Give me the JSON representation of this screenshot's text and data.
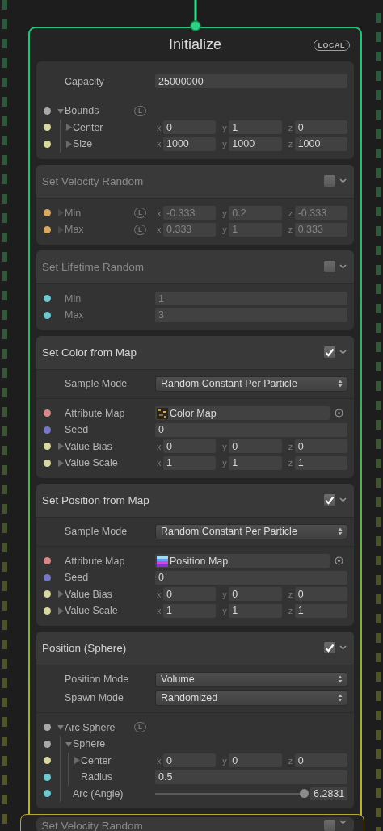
{
  "context": {
    "title": "Initialize",
    "space_badge": "LOCAL"
  },
  "blocks": [
    {
      "kind": "context-settings",
      "settings": [
        {
          "kind": "field",
          "label": "Capacity",
          "value": "25000000"
        }
      ],
      "ports": [
        {
          "kind": "group",
          "label": "Bounds",
          "color": "#a8a8a8",
          "expanded": true,
          "space_badge": "L",
          "children": [
            {
              "kind": "vector",
              "label": "Center",
              "color": "#d8d8a0",
              "expanded": false,
              "components": [
                {
                  "axis": "x",
                  "value": "0"
                },
                {
                  "axis": "y",
                  "value": "1"
                },
                {
                  "axis": "z",
                  "value": "0"
                }
              ]
            },
            {
              "kind": "vector",
              "label": "Size",
              "color": "#d8d8a0",
              "expanded": false,
              "components": [
                {
                  "axis": "x",
                  "value": "1000"
                },
                {
                  "axis": "y",
                  "value": "1000"
                },
                {
                  "axis": "z",
                  "value": "1000"
                }
              ]
            }
          ]
        }
      ]
    },
    {
      "kind": "block",
      "title": "Set Velocity Random",
      "enabled": false,
      "expanded": true,
      "ports": [
        {
          "kind": "vector",
          "label": "Min",
          "color": "#d8a860",
          "expanded": false,
          "space_badge": "L",
          "components": [
            {
              "axis": "x",
              "value": "-0.333"
            },
            {
              "axis": "y",
              "value": "0.2"
            },
            {
              "axis": "z",
              "value": "-0.333"
            }
          ]
        },
        {
          "kind": "vector",
          "label": "Max",
          "color": "#d8a860",
          "expanded": false,
          "space_badge": "L",
          "components": [
            {
              "axis": "x",
              "value": "0.333"
            },
            {
              "axis": "y",
              "value": "1"
            },
            {
              "axis": "z",
              "value": "0.333"
            }
          ]
        }
      ]
    },
    {
      "kind": "block",
      "title": "Set Lifetime Random",
      "enabled": false,
      "expanded": true,
      "ports": [
        {
          "kind": "field",
          "label": "Min",
          "color": "#70c8d0",
          "value": "1"
        },
        {
          "kind": "field",
          "label": "Max",
          "color": "#70c8d0",
          "value": "3"
        }
      ]
    },
    {
      "kind": "block",
      "title": "Set Color from Map",
      "enabled": true,
      "expanded": true,
      "settings": [
        {
          "kind": "dropdown",
          "label": "Sample Mode",
          "value": "Random Constant Per Particle"
        }
      ],
      "ports": [
        {
          "kind": "texture",
          "label": "Attribute Map",
          "color": "#d88888",
          "value": "Color Map"
        },
        {
          "kind": "field",
          "label": "Seed",
          "color": "#7878c8",
          "value": "0"
        },
        {
          "kind": "vector",
          "label": "Value Bias",
          "color": "#d8d8a0",
          "expanded": false,
          "components": [
            {
              "axis": "x",
              "value": "0"
            },
            {
              "axis": "y",
              "value": "0"
            },
            {
              "axis": "z",
              "value": "0"
            }
          ]
        },
        {
          "kind": "vector",
          "label": "Value Scale",
          "color": "#d8d8a0",
          "expanded": false,
          "components": [
            {
              "axis": "x",
              "value": "1"
            },
            {
              "axis": "y",
              "value": "1"
            },
            {
              "axis": "z",
              "value": "1"
            }
          ]
        }
      ]
    },
    {
      "kind": "block",
      "title": "Set Position from Map",
      "enabled": true,
      "expanded": true,
      "settings": [
        {
          "kind": "dropdown",
          "label": "Sample Mode",
          "value": "Random Constant Per Particle"
        }
      ],
      "ports": [
        {
          "kind": "texture",
          "label": "Attribute Map",
          "color": "#d88888",
          "value": "Position Map"
        },
        {
          "kind": "field",
          "label": "Seed",
          "color": "#7878c8",
          "value": "0"
        },
        {
          "kind": "vector",
          "label": "Value Bias",
          "color": "#d8d8a0",
          "expanded": false,
          "components": [
            {
              "axis": "x",
              "value": "0"
            },
            {
              "axis": "y",
              "value": "0"
            },
            {
              "axis": "z",
              "value": "0"
            }
          ]
        },
        {
          "kind": "vector",
          "label": "Value Scale",
          "color": "#d8d8a0",
          "expanded": false,
          "components": [
            {
              "axis": "x",
              "value": "1"
            },
            {
              "axis": "y",
              "value": "1"
            },
            {
              "axis": "z",
              "value": "1"
            }
          ]
        }
      ]
    },
    {
      "kind": "block",
      "title": "Position (Sphere)",
      "enabled": true,
      "expanded": true,
      "settings": [
        {
          "kind": "dropdown",
          "label": "Position Mode",
          "value": "Volume"
        },
        {
          "kind": "dropdown",
          "label": "Spawn Mode",
          "value": "Randomized"
        }
      ],
      "ports": [
        {
          "kind": "group",
          "label": "Arc Sphere",
          "color": "#a8a8a8",
          "expanded": true,
          "space_badge": "L",
          "children": [
            {
              "kind": "group",
              "label": "Sphere",
              "color": "#a8a8a8",
              "expanded": true,
              "children": [
                {
                  "kind": "vector",
                  "label": "Center",
                  "color": "#d8d8a0",
                  "expanded": false,
                  "components": [
                    {
                      "axis": "x",
                      "value": "0"
                    },
                    {
                      "axis": "y",
                      "value": "0"
                    },
                    {
                      "axis": "z",
                      "value": "0"
                    }
                  ]
                },
                {
                  "kind": "field",
                  "label": "Radius",
                  "color": "#70c8d0",
                  "value": "0.5"
                }
              ]
            },
            {
              "kind": "slider",
              "label": "Arc (Angle)",
              "color": "#70c8d0",
              "level": 0.98,
              "value": "6.2831"
            }
          ]
        }
      ]
    }
  ],
  "next_context": {
    "blocks": [
      {
        "kind": "block",
        "title": "Set Velocity Random",
        "enabled": false,
        "expanded": true
      }
    ]
  }
}
